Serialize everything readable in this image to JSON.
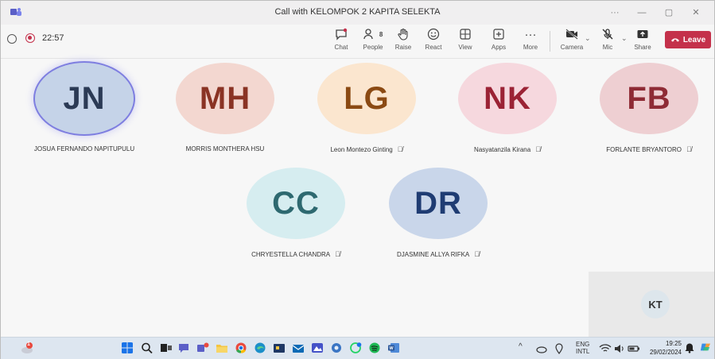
{
  "window": {
    "title": "Call with KELOMPOK 2 KAPITA SELEKTA",
    "controls": [
      "···",
      "—",
      "▢",
      "✕"
    ]
  },
  "toolbar": {
    "timer": "22:57",
    "people_count": "8",
    "buttons": {
      "chat": "Chat",
      "people": "People",
      "raise": "Raise",
      "react": "React",
      "view": "View",
      "apps": "Apps",
      "more": "More",
      "camera": "Camera",
      "mic": "Mic",
      "share": "Share",
      "leave": "Leave"
    }
  },
  "participants": [
    {
      "initials": "JN",
      "name": "JOSUA FERNANDO NAPITUPULU",
      "muted": false,
      "bg": "#c5d3e8",
      "fg": "#2b3a55"
    },
    {
      "initials": "MH",
      "name": "MORRIS MONTHERA HSU",
      "muted": false,
      "bg": "#f3d7d0",
      "fg": "#8a3324"
    },
    {
      "initials": "LG",
      "name": "Leon Montezo Ginting",
      "muted": true,
      "bg": "#fbe6cf",
      "fg": "#8b4a13"
    },
    {
      "initials": "NK",
      "name": "Nasyatanzila Kirana",
      "muted": true,
      "bg": "#f6d8de",
      "fg": "#9b2335"
    },
    {
      "initials": "FB",
      "name": "FORLANTE BRYANTORO",
      "muted": true,
      "bg": "#eecfd2",
      "fg": "#8e2b35"
    },
    {
      "initials": "CC",
      "name": "CHRYESTELLA CHANDRA",
      "muted": true,
      "bg": "#d6edf0",
      "fg": "#2e6970"
    },
    {
      "initials": "DR",
      "name": "DJASMINE ALLYA RIFKA",
      "muted": true,
      "bg": "#c9d6ea",
      "fg": "#1f3c73"
    }
  ],
  "self": {
    "initials": "KT"
  },
  "taskbar": {
    "lang_top": "ENG",
    "lang_bottom": "INTL",
    "time": "19:25",
    "date": "29/02/2024",
    "notification_badge": "1",
    "colors": {
      "teams": "#5b5fc7",
      "chrome_blue": "#1a73e8",
      "whatsapp": "#25d366",
      "word": "#2b579a"
    }
  }
}
